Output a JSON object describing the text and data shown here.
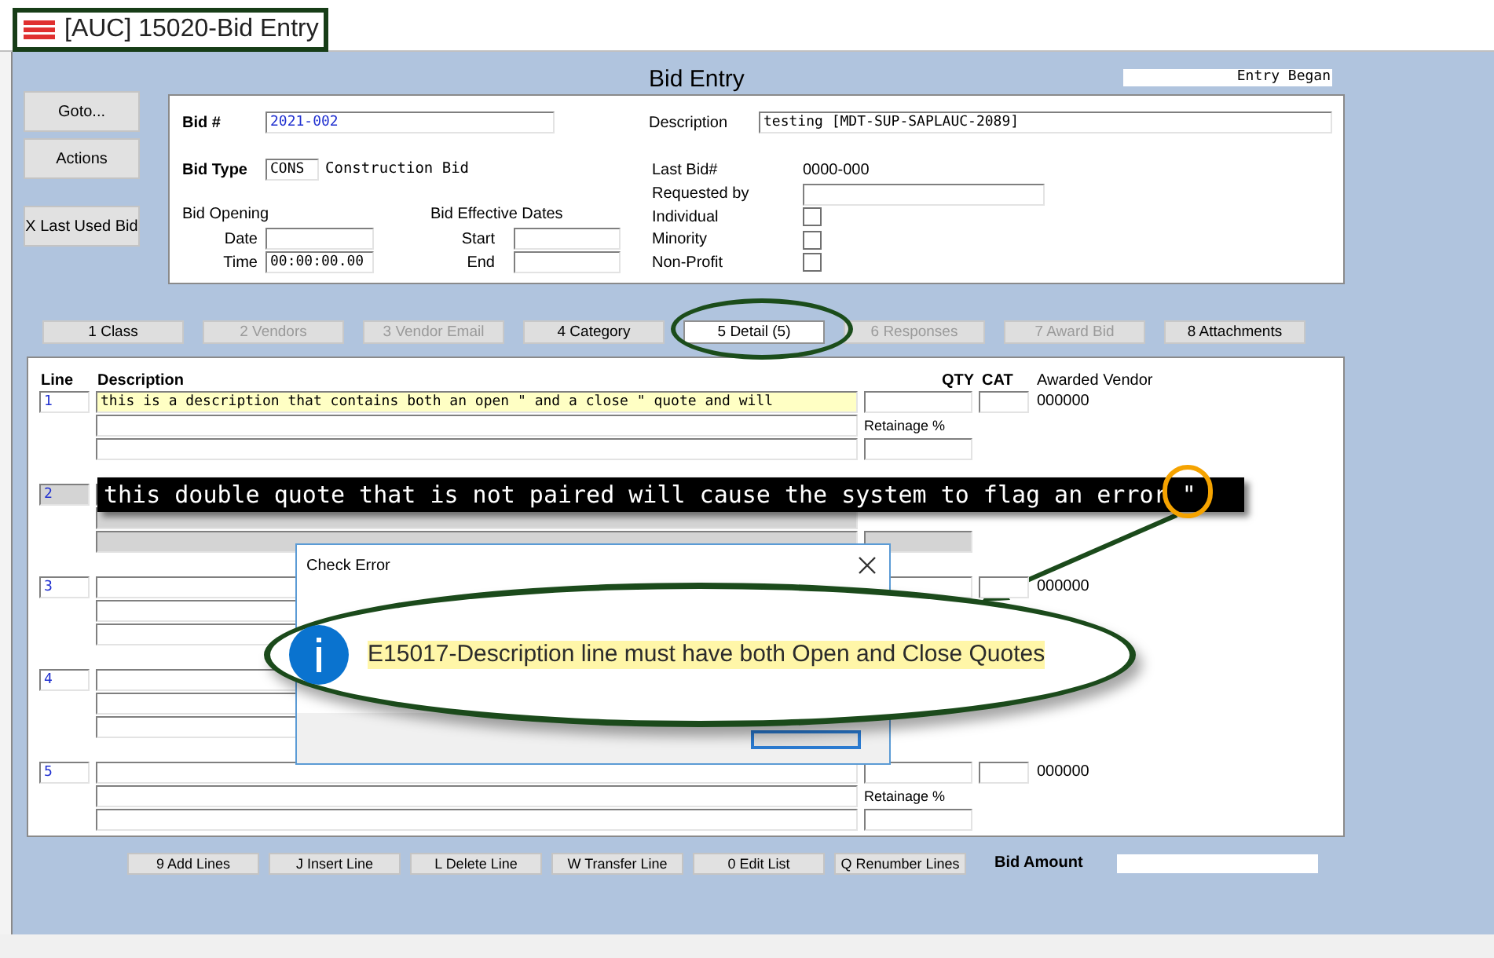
{
  "window": {
    "title": "[AUC] 15020-Bid Entry"
  },
  "side_buttons": [
    "Goto...",
    "Actions",
    "X Last Used Bid"
  ],
  "form_title": "Bid Entry",
  "entry_status": "Entry Began",
  "header": {
    "bid_number_label": "Bid #",
    "bid_number": "2021-002",
    "bid_type_label": "Bid Type",
    "bid_type_code": "CONS",
    "bid_type_name": "Construction Bid",
    "bid_opening_label": "Bid Opening",
    "date_label": "Date",
    "time_label": "Time",
    "time_value": "00:00:00.00",
    "effective_dates_label": "Bid Effective Dates",
    "start_label": "Start",
    "end_label": "End",
    "description_label": "Description",
    "description": "testing [MDT-SUP-SAPLAUC-2089]",
    "last_bid_label": "Last Bid#",
    "last_bid": "0000-000",
    "requested_by_label": "Requested by",
    "flags": [
      {
        "label": "Individual",
        "checked": false
      },
      {
        "label": "Minority",
        "checked": false
      },
      {
        "label": "Non-Profit",
        "checked": false
      }
    ]
  },
  "tabs": [
    {
      "label": "1 Class",
      "selected": false,
      "disabled": false
    },
    {
      "label": "2 Vendors",
      "selected": false,
      "disabled": true
    },
    {
      "label": "3 Vendor Email",
      "selected": false,
      "disabled": true
    },
    {
      "label": "4 Category",
      "selected": false,
      "disabled": false
    },
    {
      "label": "5 Detail (5)",
      "selected": true,
      "disabled": false
    },
    {
      "label": "6 Responses",
      "selected": false,
      "disabled": true
    },
    {
      "label": "7 Award Bid",
      "selected": false,
      "disabled": true
    },
    {
      "label": "8 Attachments",
      "selected": false,
      "disabled": false
    }
  ],
  "detail": {
    "columns": [
      "Line",
      "Description",
      "QTY",
      "CAT",
      "Awarded Vendor"
    ],
    "lines": [
      {
        "number": "1",
        "description": "this is a description that contains both an open \" and a close \" quote and will",
        "highlighted": true,
        "disabled": false,
        "retainage_label": "Retainage %",
        "vendor": "000000"
      },
      {
        "number": "2",
        "highlighted": false,
        "disabled": true
      },
      {
        "number": "3",
        "highlighted": false,
        "disabled": false,
        "vendor": "000000"
      },
      {
        "number": "4",
        "highlighted": false,
        "disabled": false
      },
      {
        "number": "5",
        "highlighted": false,
        "disabled": false,
        "retainage_label": "Retainage %",
        "vendor": "000000"
      }
    ]
  },
  "bottom_buttons": [
    "9 Add Lines",
    "J Insert Line",
    "L Delete Line",
    "W Transfer Line",
    "0 Edit List",
    "Q Renumber Lines"
  ],
  "bid_amount_label": "Bid Amount",
  "callout": {
    "text": "this double quote that is not paired will cause the system to flag an error \""
  },
  "dialog": {
    "title": "Check Error",
    "message": "E15017-Description line must have both Open and Close Quotes"
  }
}
